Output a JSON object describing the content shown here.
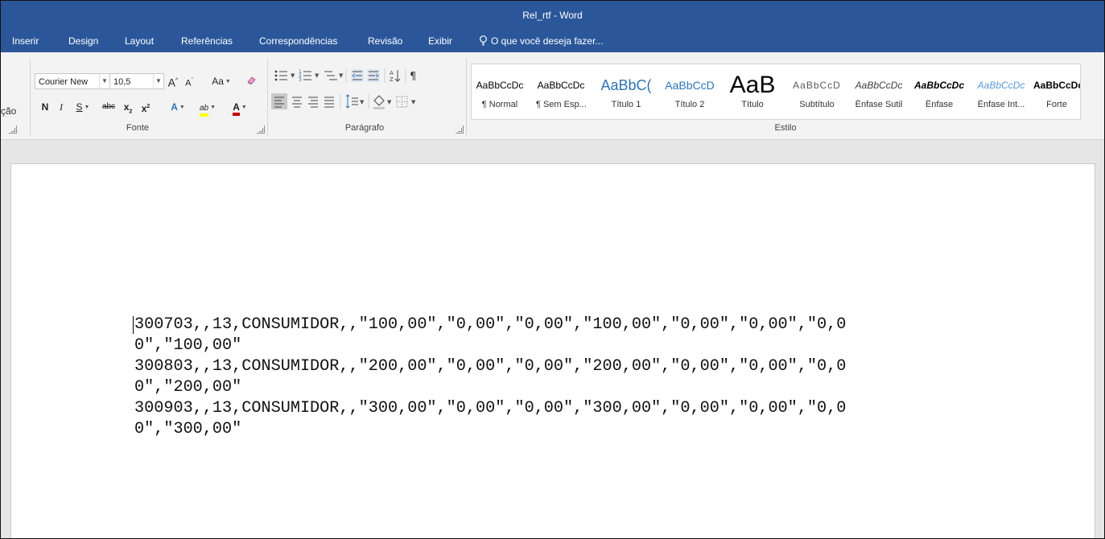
{
  "window": {
    "title": "Rel_rtf - Word"
  },
  "tabs": [
    "Inserir",
    "Design",
    "Layout",
    "Referências",
    "Correspondências",
    "Revisão",
    "Exibir"
  ],
  "tell_me": {
    "placeholder": "O que você deseja fazer..."
  },
  "ribbon": {
    "left_partial_label": "ção",
    "font": {
      "group_label": "Fonte",
      "font_name": "Courier New",
      "font_size": "10,5",
      "grow": "A",
      "shrink": "A",
      "change_case": "Aa",
      "bold": "N",
      "italic": "I",
      "underline": "S",
      "strikethrough": "abc",
      "subscript": "x",
      "superscript": "x",
      "text_effects": "A",
      "highlight": "ab",
      "font_color": "A"
    },
    "paragraph": {
      "group_label": "Parágrafo"
    },
    "styles": {
      "group_label": "Estilo",
      "items": [
        {
          "sample": "AaBbCcDc",
          "name": "¶ Normal"
        },
        {
          "sample": "AaBbCcDc",
          "name": "¶ Sem Esp..."
        },
        {
          "sample": "AaBbC(",
          "name": "Título 1"
        },
        {
          "sample": "AaBbCcD",
          "name": "Título 2"
        },
        {
          "sample": "AaB",
          "name": "Título"
        },
        {
          "sample": "AaBbCcD",
          "name": "Subtítulo"
        },
        {
          "sample": "AaBbCcDc",
          "name": "Ênfase Sutil"
        },
        {
          "sample": "AaBbCcDc",
          "name": "Ênfase"
        },
        {
          "sample": "AaBbCcDc",
          "name": "Ênfase Int..."
        },
        {
          "sample": "AaBbCcDc",
          "name": "Forte"
        }
      ]
    }
  },
  "document": {
    "lines": [
      "300703,,13,CONSUMIDOR,,\"100,00\",\"0,00\",\"0,00\",\"100,00\",\"0,00\",\"0,00\",\"0,0",
      "0\",\"100,00\"",
      "300803,,13,CONSUMIDOR,,\"200,00\",\"0,00\",\"0,00\",\"200,00\",\"0,00\",\"0,00\",\"0,0",
      "0\",\"200,00\"",
      "300903,,13,CONSUMIDOR,,\"300,00\",\"0,00\",\"0,00\",\"300,00\",\"0,00\",\"0,00\",\"0,0",
      "0\",\"300,00\""
    ]
  },
  "colors": {
    "title_bar": "#2b579a",
    "ribbon_bg": "#f3f3f3",
    "canvas_bg": "#e6e6e6",
    "heading_blue": "#2e74b5",
    "underline_red": "#c00000",
    "highlight_yellow": "#ffff00"
  }
}
